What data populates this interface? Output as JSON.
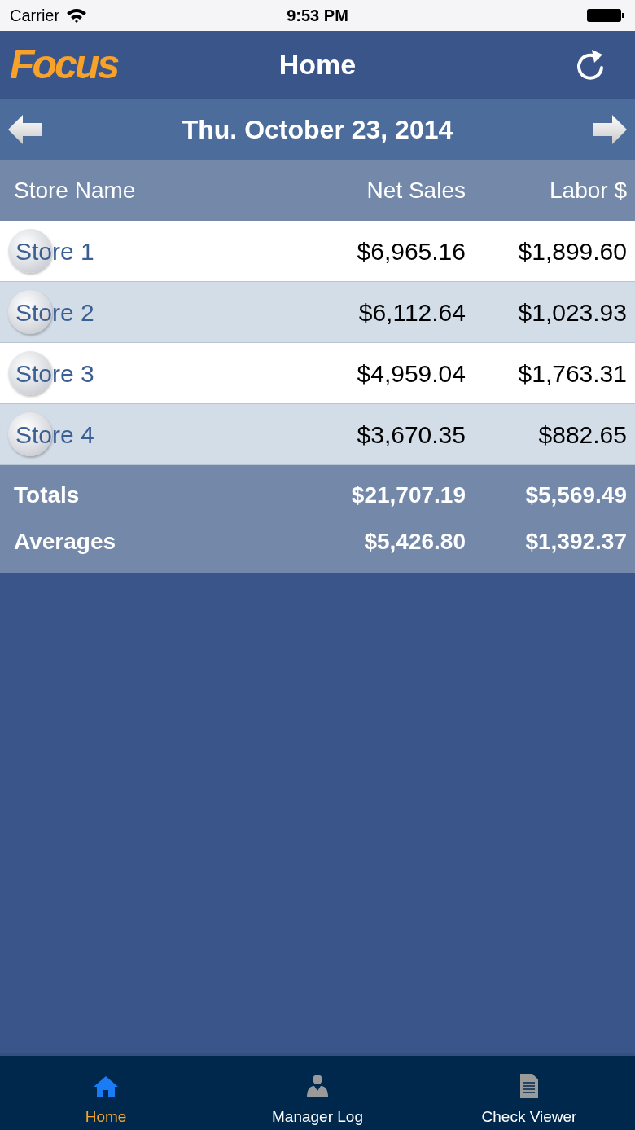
{
  "status_bar": {
    "carrier": "Carrier",
    "time": "9:53 PM"
  },
  "header": {
    "logo": "Focus",
    "title": "Home"
  },
  "date_bar": {
    "date": "Thu. October 23, 2014"
  },
  "table": {
    "columns": [
      "Store Name",
      "Net Sales",
      "Labor $"
    ],
    "rows": [
      {
        "store": "Store 1",
        "net_sales": "$6,965.16",
        "labor": "$1,899.60"
      },
      {
        "store": "Store 2",
        "net_sales": "$6,112.64",
        "labor": "$1,023.93"
      },
      {
        "store": "Store 3",
        "net_sales": "$4,959.04",
        "labor": "$1,763.31"
      },
      {
        "store": "Store 4",
        "net_sales": "$3,670.35",
        "labor": "$882.65"
      }
    ],
    "summary": [
      {
        "label": "Totals",
        "net_sales": "$21,707.19",
        "labor": "$5,569.49"
      },
      {
        "label": "Averages",
        "net_sales": "$5,426.80",
        "labor": "$1,392.37"
      }
    ]
  },
  "tab_bar": [
    {
      "kind": "home",
      "label": "Home",
      "selected": true
    },
    {
      "kind": "person",
      "label": "Manager Log",
      "selected": false
    },
    {
      "kind": "document",
      "label": "Check Viewer",
      "selected": false
    }
  ]
}
